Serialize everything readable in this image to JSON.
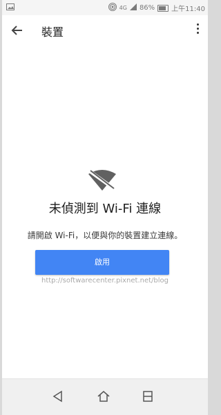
{
  "status_bar": {
    "network": "4G",
    "battery": "86%",
    "time": "上午11:40"
  },
  "app_bar": {
    "title": "裝置"
  },
  "content": {
    "headline": "未偵測到 Wi-Fi 連線",
    "message": "請開啟 Wi-Fi，以便與你的裝置建立連線。",
    "enable_button": "啟用",
    "watermark": "http://softwarecenter.pixnet.net/blog"
  },
  "icons": {
    "back": "arrow-back-icon",
    "more": "more-vert-icon",
    "wifi_off": "wifi-off-icon",
    "nav_back": "triangle-back-icon",
    "nav_home": "home-icon",
    "nav_recents": "recents-icon"
  },
  "colors": {
    "accent": "#4285f4"
  }
}
